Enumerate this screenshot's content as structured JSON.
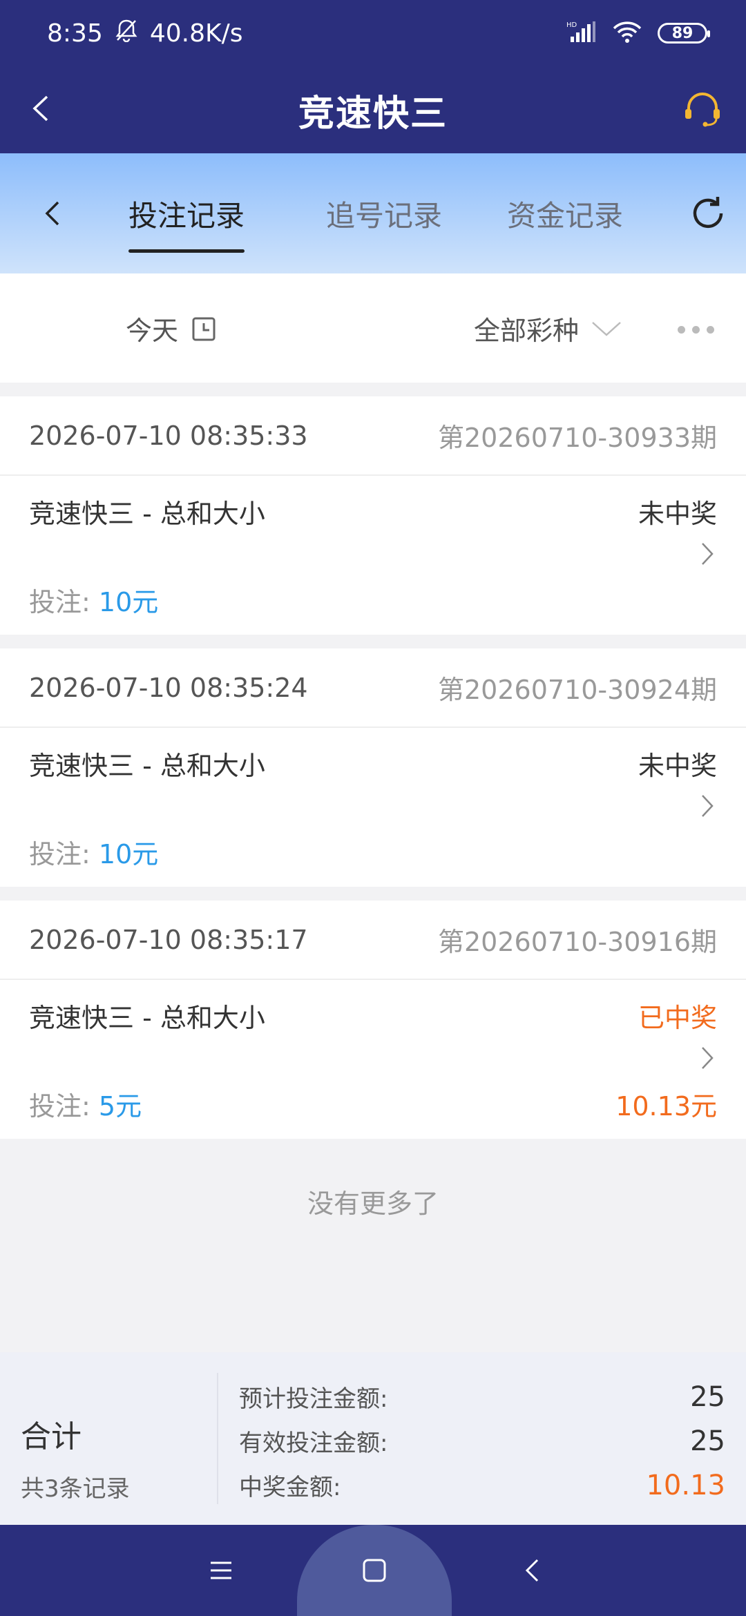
{
  "status_bar": {
    "time": "8:35",
    "speed": "40.8K/s",
    "network": "HD",
    "battery": "89"
  },
  "app_bar": {
    "title": "竞速快三"
  },
  "tabs": [
    {
      "label": "投注记录",
      "active": true
    },
    {
      "label": "追号记录",
      "active": false
    },
    {
      "label": "资金记录",
      "active": false
    }
  ],
  "filters": {
    "date": "今天",
    "lottery": "全部彩种"
  },
  "records": [
    {
      "time": "2026-07-10 08:35:33",
      "issue": "第20260710-30933期",
      "name": "竞速快三 - 总和大小",
      "status": "未中奖",
      "bet_label": "投注: ",
      "bet": "10元",
      "prize": ""
    },
    {
      "time": "2026-07-10 08:35:24",
      "issue": "第20260710-30924期",
      "name": "竞速快三 - 总和大小",
      "status": "未中奖",
      "bet_label": "投注: ",
      "bet": "10元",
      "prize": ""
    },
    {
      "time": "2026-07-10 08:35:17",
      "issue": "第20260710-30916期",
      "name": "竞速快三 - 总和大小",
      "status": "已中奖",
      "bet_label": "投注: ",
      "bet": "5元",
      "prize": "10.13元"
    }
  ],
  "no_more": "没有更多了",
  "summary": {
    "label": "合计",
    "count": "共3条记录",
    "rows": [
      {
        "k": "预计投注金额:",
        "v": "25"
      },
      {
        "k": "有效投注金额:",
        "v": "25"
      },
      {
        "k": "中奖金额:",
        "v": "10.13"
      }
    ]
  },
  "colors": {
    "header": "#2b2f7d",
    "accent_blue": "#2a9ae8",
    "accent_orange": "#f26b1d"
  }
}
